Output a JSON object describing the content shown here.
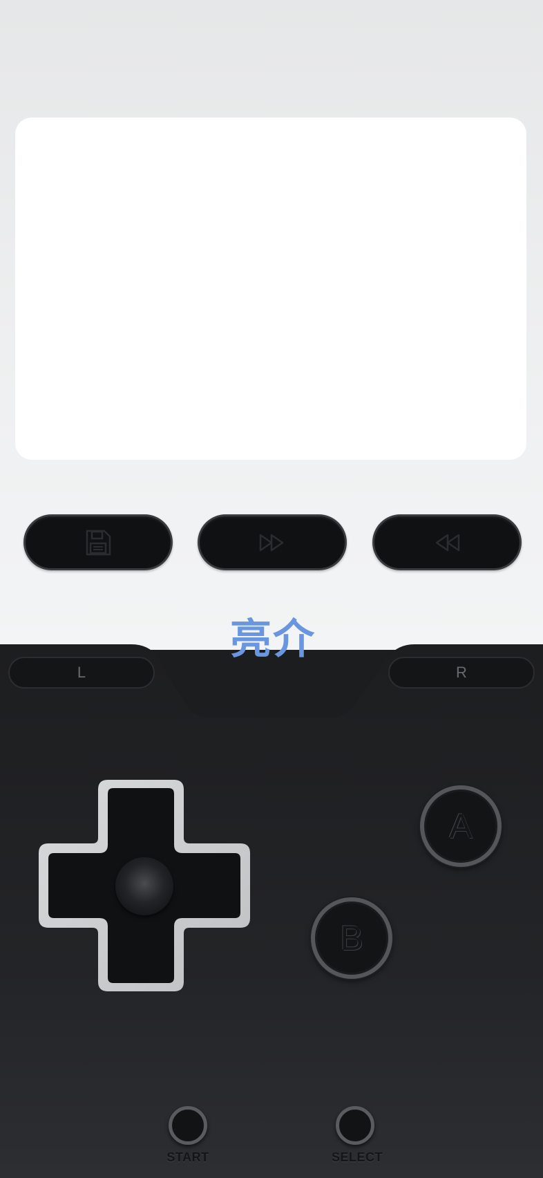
{
  "app": {
    "logo_text": "亮介"
  },
  "toolbar": {
    "save_icon": "floppy-disk-icon",
    "fast_forward_icon": "fast-forward-icon",
    "rewind_icon": "rewind-icon"
  },
  "shoulders": {
    "left_label": "L",
    "right_label": "R"
  },
  "dpad": {
    "icon": "dpad-icon"
  },
  "face_buttons": {
    "a_label": "A",
    "b_label": "B"
  },
  "system_buttons": {
    "start_label": "START",
    "select_label": "SELECT"
  },
  "colors": {
    "logo": "#6a96df",
    "shell_top": "#eeeff0",
    "shell_bottom": "#1e1f21",
    "screen": "#ffffff"
  }
}
